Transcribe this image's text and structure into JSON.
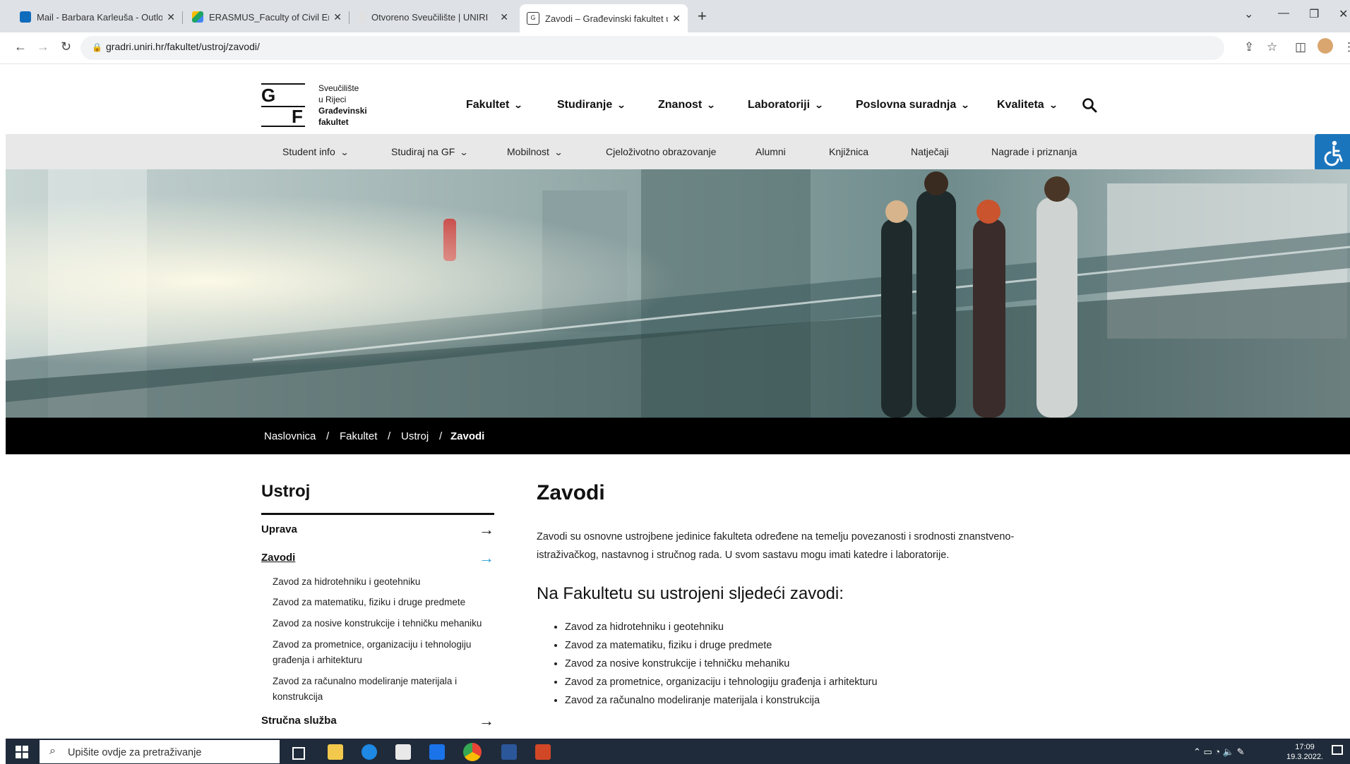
{
  "browser": {
    "tabs": [
      {
        "title": "Mail - Barbara Karleuša - Outlook",
        "color": "#0f6cbd"
      },
      {
        "title": "ERASMUS_Faculty of Civil Engineering",
        "color": "#1fa463"
      },
      {
        "title": "Otvoreno Sveučilište | UNIRI",
        "color": "#cfcfcf"
      },
      {
        "title": "Zavodi – Građevinski fakultet u Rijeci",
        "color": "#111111"
      }
    ],
    "url": "gradri.uniri.hr/fakultet/ustroj/zavodi/"
  },
  "logo": {
    "g": "G",
    "f": "F",
    "line1": "Sveučilište",
    "line2": "u Rijeci",
    "line3": "Građevinski",
    "line4": "fakultet"
  },
  "main_nav": [
    "Fakultet",
    "Studiranje",
    "Znanost",
    "Laboratoriji",
    "Poslovna suradnja",
    "Kvaliteta"
  ],
  "sub_nav": [
    {
      "label": "Student info",
      "dropdown": true
    },
    {
      "label": "Studiraj na GF",
      "dropdown": true
    },
    {
      "label": "Mobilnost",
      "dropdown": true
    },
    {
      "label": "Cjeloživotno obrazovanje",
      "dropdown": false
    },
    {
      "label": "Alumni",
      "dropdown": false
    },
    {
      "label": "Knjižnica",
      "dropdown": false
    },
    {
      "label": "Natječaji",
      "dropdown": false
    },
    {
      "label": "Nagrade i priznanja",
      "dropdown": false
    }
  ],
  "breadcrumb": [
    "Naslovnica",
    "Fakultet",
    "Ustroj",
    "Zavodi"
  ],
  "sidebar": {
    "title": "Ustroj",
    "items": [
      "Uprava",
      "Zavodi",
      "Stručna služba"
    ],
    "sub_items": [
      "Zavod za hidrotehniku i geotehniku",
      "Zavod za matematiku, fiziku i druge predmete",
      "Zavod za nosive konstrukcije i tehničku mehaniku",
      "Zavod za prometnice, organizaciju i tehnologiju građenja i arhitekturu",
      "Zavod za računalno modeliranje materijala i konstrukcija"
    ]
  },
  "content": {
    "title": "Zavodi",
    "intro": "Zavodi su osnovne ustrojbene jedinice fakulteta određene na temelju povezanosti i srodnosti znanstveno-istraživačkog, nastavnog i stručnog rada. U svom sastavu mogu imati katedre i laboratorije.",
    "section_title": "Na Fakultetu su ustrojeni sljedeći zavodi:",
    "list": [
      "Zavod za hidrotehniku i geotehniku",
      "Zavod za matematiku, fiziku i druge predmete",
      "Zavod za nosive konstrukcije i tehničku mehaniku",
      "Zavod za prometnice, organizaciju i tehnologiju građenja i arhitekturu",
      "Zavod za računalno modeliranje materijala i konstrukcija"
    ]
  },
  "taskbar": {
    "search_placeholder": "Upišite ovdje za pretraživanje",
    "time": "17:09",
    "date": "19.3.2022."
  },
  "colors": {
    "accent": "#1b75bc",
    "active_arrow": "#2a9fd6",
    "breadcrumb_bg": "#000000",
    "subnav_bg": "#e8e8e8"
  }
}
